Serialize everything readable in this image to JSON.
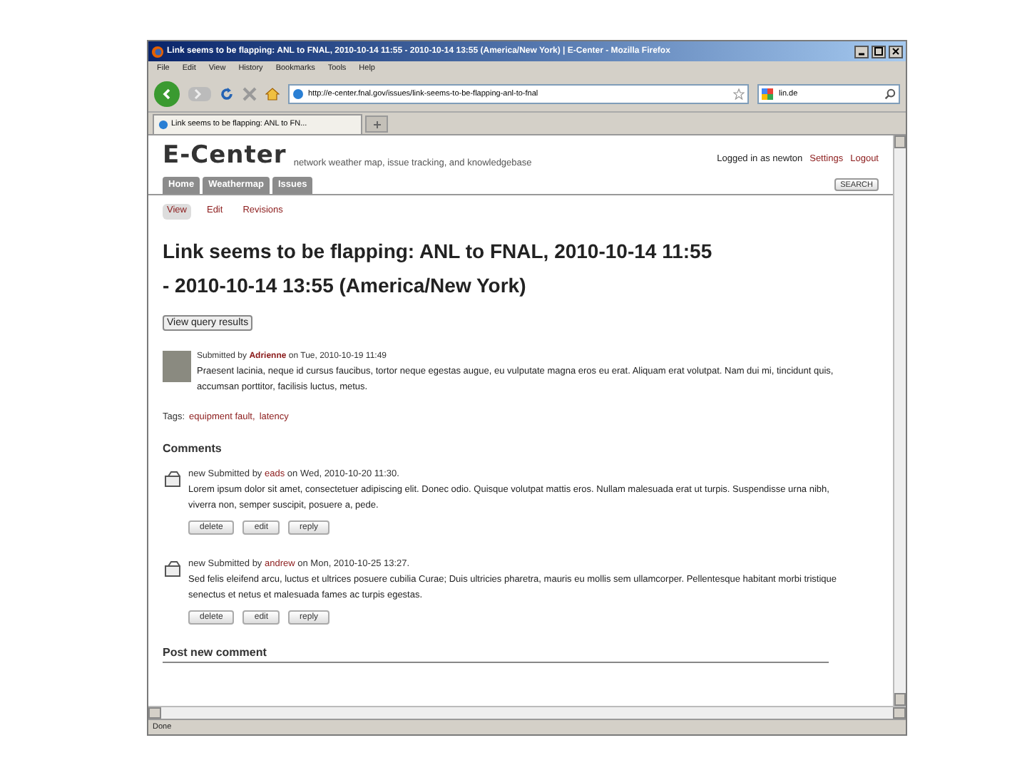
{
  "window": {
    "title": "Link seems to be flapping: ANL to FNAL, 2010-10-14 11:55 - 2010-10-14 13:55 (America/New York) | E-Center - Mozilla Firefox"
  },
  "menu": [
    "File",
    "Edit",
    "View",
    "History",
    "Bookmarks",
    "Tools",
    "Help"
  ],
  "address": {
    "value": "http://e-center.fnal.gov/issues/link-seems-to-be-flapping-anl-to-fnal"
  },
  "search": {
    "value": "lin.de"
  },
  "tabs": [
    {
      "label": "Link seems to be flapping: ANL to FN...",
      "selected": true
    }
  ],
  "site": {
    "name": "E-Center",
    "tagline": "network weather map, issue tracking, and knowledgebase",
    "login": "Logged in as newton",
    "links": [
      "Settings",
      "Logout"
    ]
  },
  "nav": [
    {
      "label": "Home",
      "selected": false
    },
    {
      "label": "Weathermap",
      "selected": false
    },
    {
      "label": "Issues",
      "selected": false
    }
  ],
  "search_button": "SEARCH",
  "subtabs": [
    {
      "label": "View",
      "selected": true
    },
    {
      "label": "Edit",
      "selected": false
    },
    {
      "label": "Revisions",
      "selected": false
    }
  ],
  "heading": "Link seems to be flapping: ANL to FNAL, 2010-10-14 11:55 - 2010-10-14 13:55 (America/New York)",
  "query_button": "View query results",
  "post": {
    "prefix": "Submitted by",
    "author": "Adrienne",
    "date": "on Tue, 2010-10-19 11:49",
    "body": "Praesent lacinia, neque id cursus faucibus, tortor neque egestas augue, eu vulputate magna eros eu erat. Aliquam erat volutpat. Nam dui mi, tincidunt quis, accumsan porttitor, facilisis luctus, metus."
  },
  "tags": {
    "label": "Tags:",
    "items": [
      "equipment fault,",
      "latency"
    ]
  },
  "comments_title": "Comments",
  "comments": [
    {
      "badge": "new",
      "prefix": "Submitted by",
      "author": "eads",
      "date": "on Wed, 2010-10-20 11:30.",
      "body": "Lorem ipsum dolor sit amet, consectetuer adipiscing elit. Donec odio. Quisque volutpat mattis eros. Nullam malesuada erat ut turpis. Suspendisse urna nibh, viverra non, semper suscipit, posuere a, pede.",
      "actions": [
        "delete",
        "edit",
        "reply"
      ]
    },
    {
      "badge": "new",
      "prefix": "Submitted by",
      "author": "andrew",
      "date": "on Mon, 2010-10-25 13:27.",
      "body": "Sed felis eleifend arcu, luctus et ultrices posuere cubilia Curae; Duis ultricies pharetra, mauris eu mollis sem ullamcorper. Pellentesque habitant morbi tristique senectus et netus et malesuada fames ac turpis egestas.",
      "actions": [
        "delete",
        "edit",
        "reply"
      ]
    }
  ],
  "post_new": "Post new comment",
  "status_bar": "Done"
}
